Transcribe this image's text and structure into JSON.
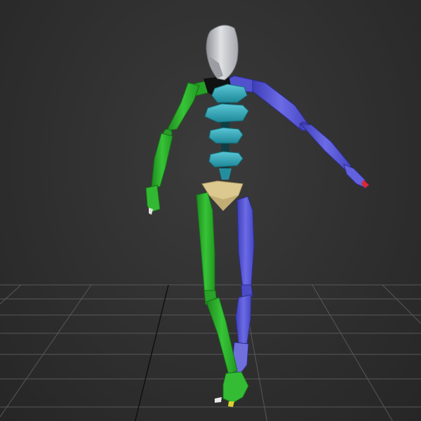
{
  "viewport": {
    "view": "Perspective",
    "background": "#2f2f2f",
    "grid_color": "#585858",
    "grid_axis_color": "#101010"
  },
  "rig": {
    "head": {
      "color": "#c8ccd2"
    },
    "spine": {
      "color": "#2aa3b5",
      "segments": 4
    },
    "pelvis": {
      "color": "#d8c58c"
    },
    "left_side": {
      "color": "#2fb22f"
    },
    "right_side": {
      "color": "#5555d6"
    },
    "hand_tip_color": "#d8283a",
    "foot_tip_color": "#d8d030"
  }
}
